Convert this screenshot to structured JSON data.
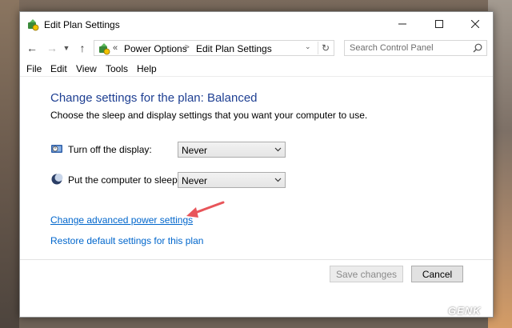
{
  "window": {
    "title": "Edit Plan Settings"
  },
  "address": {
    "separator": "«",
    "crumbs": [
      "Power Options",
      "Edit Plan Settings"
    ],
    "search_placeholder": "Search Control Panel"
  },
  "menu": [
    "File",
    "Edit",
    "View",
    "Tools",
    "Help"
  ],
  "main": {
    "heading": "Change settings for the plan: Balanced",
    "subtitle": "Choose the sleep and display settings that you want your computer to use.",
    "settings": [
      {
        "label": "Turn off the display:",
        "value": "Never",
        "icon": "display-timer-icon"
      },
      {
        "label": "Put the computer to sleep:",
        "value": "Never",
        "icon": "sleep-moon-icon"
      }
    ],
    "links": {
      "advanced": "Change advanced power settings",
      "restore": "Restore default settings for this plan"
    }
  },
  "footer": {
    "save": "Save changes",
    "cancel": "Cancel"
  },
  "watermark": "GENK",
  "colors": {
    "heading": "#1e3f92",
    "link": "#0066cc",
    "annotation_arrow": "#e8555a"
  }
}
